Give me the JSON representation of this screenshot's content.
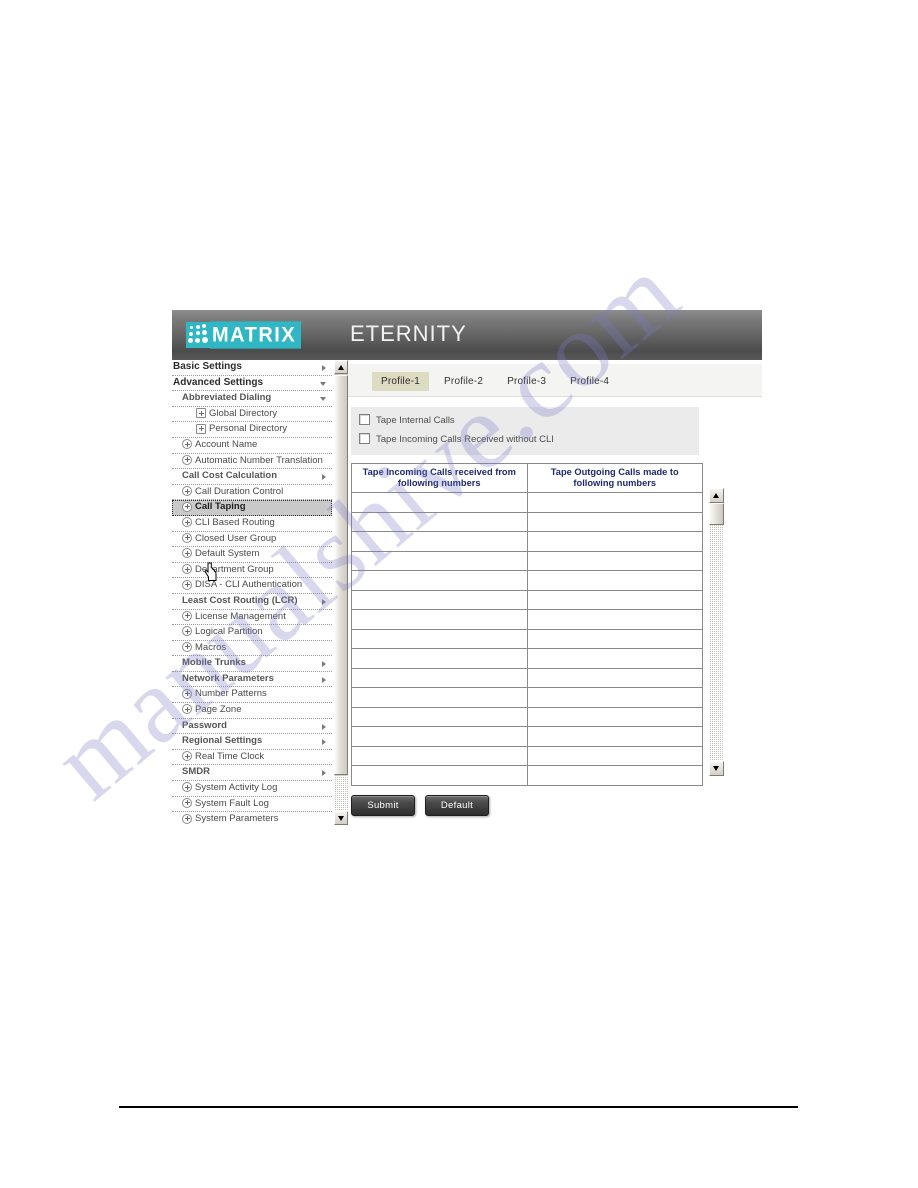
{
  "header": {
    "brand": "MATRIX",
    "product": "ETERNITY"
  },
  "sidebar": {
    "items": [
      {
        "label": "Basic Settings",
        "level": "lvl0",
        "icon": "arrow-right-icon",
        "selected": false
      },
      {
        "label": "Advanced Settings",
        "level": "lvl0",
        "icon": "arrow-down-icon",
        "selected": false
      },
      {
        "label": "Abbreviated Dialing",
        "level": "lvl1",
        "icon": "arrow-down-icon",
        "selected": false
      },
      {
        "label": "Global Directory",
        "level": "lvl-leaf2",
        "icon": "plus-square-icon",
        "selected": false
      },
      {
        "label": "Personal Directory",
        "level": "lvl-leaf2",
        "icon": "plus-square-icon",
        "selected": false
      },
      {
        "label": "Account Name",
        "level": "lvl-leaf",
        "icon": "plus-circle-icon",
        "selected": false
      },
      {
        "label": "Automatic Number Translation",
        "level": "lvl-leaf",
        "icon": "plus-circle-icon",
        "selected": false
      },
      {
        "label": "Call Cost Calculation",
        "level": "lvl1",
        "icon": "arrow-right-icon",
        "selected": false
      },
      {
        "label": "Call Duration Control",
        "level": "lvl-leaf",
        "icon": "plus-circle-icon",
        "selected": false
      },
      {
        "label": "Call Taping",
        "level": "lvl-leaf",
        "icon": "plus-circle-icon",
        "selected": true
      },
      {
        "label": "CLI Based Routing",
        "level": "lvl-leaf",
        "icon": "plus-circle-icon",
        "selected": false
      },
      {
        "label": "Closed User Group",
        "level": "lvl-leaf",
        "icon": "plus-circle-icon",
        "selected": false
      },
      {
        "label": "Default System",
        "level": "lvl-leaf",
        "icon": "plus-circle-icon",
        "selected": false
      },
      {
        "label": "Department Group",
        "level": "lvl-leaf",
        "icon": "plus-circle-icon",
        "selected": false
      },
      {
        "label": "DISA - CLI Authentication",
        "level": "lvl-leaf",
        "icon": "plus-circle-icon",
        "selected": false
      },
      {
        "label": "Least Cost Routing (LCR)",
        "level": "lvl1",
        "icon": "arrow-right-icon",
        "selected": false
      },
      {
        "label": "License Management",
        "level": "lvl-leaf",
        "icon": "plus-circle-icon",
        "selected": false
      },
      {
        "label": "Logical Partition",
        "level": "lvl-leaf",
        "icon": "plus-circle-icon",
        "selected": false
      },
      {
        "label": "Macros",
        "level": "lvl-leaf",
        "icon": "plus-circle-icon",
        "selected": false
      },
      {
        "label": "Mobile Trunks",
        "level": "lvl1",
        "icon": "arrow-right-icon",
        "selected": false
      },
      {
        "label": "Network Parameters",
        "level": "lvl1",
        "icon": "arrow-right-icon",
        "selected": false
      },
      {
        "label": "Number Patterns",
        "level": "lvl-leaf",
        "icon": "plus-circle-icon",
        "selected": false
      },
      {
        "label": "Page Zone",
        "level": "lvl-leaf",
        "icon": "plus-circle-icon",
        "selected": false
      },
      {
        "label": "Password",
        "level": "lvl1",
        "icon": "arrow-right-icon",
        "selected": false
      },
      {
        "label": "Regional Settings",
        "level": "lvl1",
        "icon": "arrow-right-icon",
        "selected": false
      },
      {
        "label": "Real Time Clock",
        "level": "lvl-leaf",
        "icon": "plus-circle-icon",
        "selected": false
      },
      {
        "label": "SMDR",
        "level": "lvl1",
        "icon": "arrow-right-icon",
        "selected": false
      },
      {
        "label": "System Activity Log",
        "level": "lvl-leaf",
        "icon": "plus-circle-icon",
        "selected": false
      },
      {
        "label": "System Fault Log",
        "level": "lvl-leaf",
        "icon": "plus-circle-icon",
        "selected": false
      },
      {
        "label": "System Parameters",
        "level": "lvl-leaf",
        "icon": "plus-circle-icon",
        "selected": false
      }
    ]
  },
  "content": {
    "tabs": [
      {
        "label": "Profile-1",
        "active": true
      },
      {
        "label": "Profile-2",
        "active": false
      },
      {
        "label": "Profile-3",
        "active": false
      },
      {
        "label": "Profile-4",
        "active": false
      }
    ],
    "checkboxes": [
      {
        "label": "Tape Internal Calls",
        "checked": false
      },
      {
        "label": "Tape Incoming Calls Received without CLI",
        "checked": false
      }
    ],
    "table": {
      "columns": [
        "Tape Incoming Calls received from following numbers",
        "Tape Outgoing Calls made to following numbers"
      ],
      "rows": [
        [
          "",
          ""
        ],
        [
          "",
          ""
        ],
        [
          "",
          ""
        ],
        [
          "",
          ""
        ],
        [
          "",
          ""
        ],
        [
          "",
          ""
        ],
        [
          "",
          ""
        ],
        [
          "",
          ""
        ],
        [
          "",
          ""
        ],
        [
          "",
          ""
        ],
        [
          "",
          ""
        ],
        [
          "",
          ""
        ],
        [
          "",
          ""
        ],
        [
          "",
          ""
        ],
        [
          "",
          ""
        ]
      ]
    },
    "buttons": [
      {
        "label": "Submit"
      },
      {
        "label": "Default"
      }
    ]
  },
  "watermark": {
    "text": "manualshive.com"
  },
  "colors": {
    "brand_teal": "#31b6c3",
    "header_gray": "#616161",
    "active_tab": "#dddbc1",
    "table_header_text": "#1c2a70",
    "selected_menu": "#c9c9c9",
    "panel_gray": "#ebebeb"
  }
}
